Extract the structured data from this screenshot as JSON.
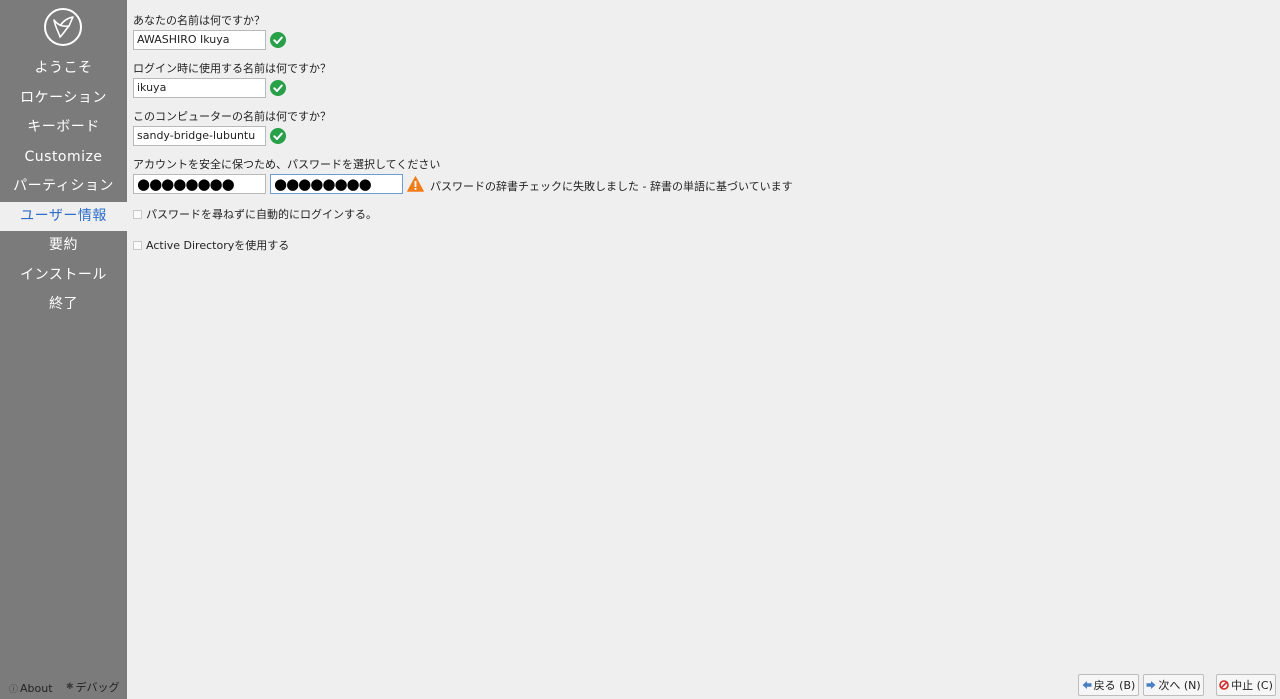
{
  "sidebar": {
    "logo_icon": "lubuntu-bird-logo-icon",
    "items": [
      {
        "label": "ようこそ",
        "active": false
      },
      {
        "label": "ロケーション",
        "active": false
      },
      {
        "label": "キーボード",
        "active": false
      },
      {
        "label": "Customize",
        "active": false
      },
      {
        "label": "パーティション",
        "active": false
      },
      {
        "label": "ユーザー情報",
        "active": true
      },
      {
        "label": "要約",
        "active": false
      },
      {
        "label": "インストール",
        "active": false
      },
      {
        "label": "終了",
        "active": false
      }
    ],
    "footer": {
      "about_label": "About",
      "about_icon": "info-icon",
      "debug_label": "デバッグ",
      "debug_icon": "bug-icon"
    }
  },
  "form": {
    "fullname": {
      "label": "あなたの名前は何ですか？",
      "value": "AWASHIRO Ikuya",
      "status_icon": "check-icon"
    },
    "login": {
      "label": "ログイン時に使用する名前は何ですか？",
      "value": "ikuya",
      "status_icon": "check-icon"
    },
    "hostname": {
      "label": "このコンピューターの名前は何ですか？",
      "value": "sandy-bridge-lubuntu",
      "status_icon": "check-icon"
    },
    "password": {
      "label": "アカウントを安全に保つため、パスワードを選択してください",
      "value_masked": "●●●●●●●●",
      "confirm_masked": "●●●●●●●●",
      "status_icon": "warning-icon",
      "status_text": "パスワードの辞書チェックに失敗しました - 辞書の単語に基づいています"
    },
    "autologin": {
      "label": "パスワードを尋ねずに自動的にログインする。",
      "checked": false
    },
    "active_directory": {
      "label": "Active Directoryを使用する",
      "checked": false
    }
  },
  "buttons": {
    "back": {
      "label": "戻る (B)",
      "icon": "arrow-left-icon"
    },
    "next": {
      "label": "次へ (N)",
      "icon": "arrow-right-icon"
    },
    "cancel": {
      "label": "中止 (C)",
      "icon": "stop-icon"
    }
  },
  "colors": {
    "sidebar_bg": "#7b7b7b",
    "active_text": "#2f6fc9",
    "ok_green": "#27a048",
    "warn_orange": "#f07d1a"
  }
}
